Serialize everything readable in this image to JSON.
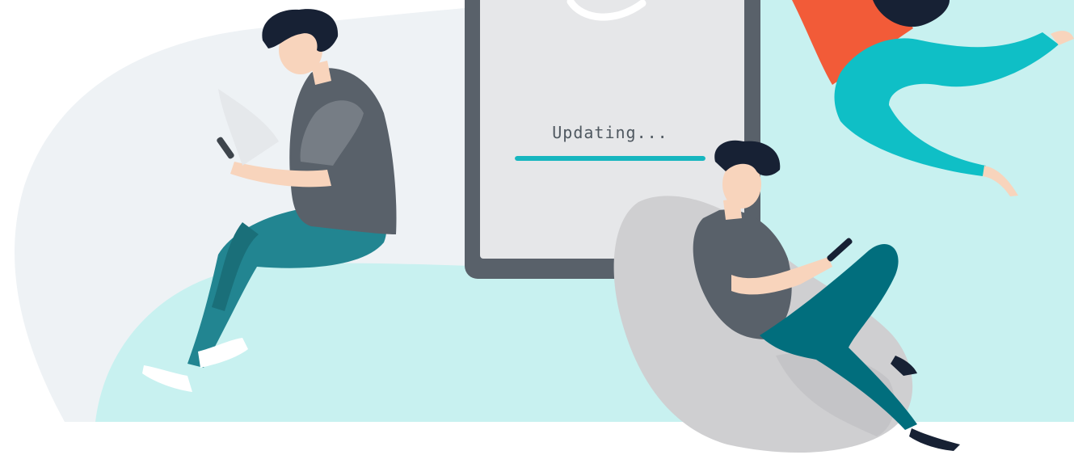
{
  "status": {
    "label": "Updating..."
  },
  "progress": {
    "fraction": 1.0
  },
  "colors": {
    "accent": "#17b6bf",
    "tablet_frame": "#59616a",
    "tablet_screen": "#e6e7e9",
    "backdrop_mint": "#c8f1f0",
    "backdrop_gray": "#eef2f5",
    "shirt_dark": "#59616a",
    "pants_teal": "#228591",
    "pants_dark": "#016e7d",
    "beanbag": "#cfcfd1",
    "flyer_shirt": "#f25b38",
    "flyer_pants": "#0fbfc6",
    "skin": "#f8d4bc",
    "hair": "#172134"
  },
  "icons": {
    "loading_spinner": "loading-spinner-icon"
  }
}
